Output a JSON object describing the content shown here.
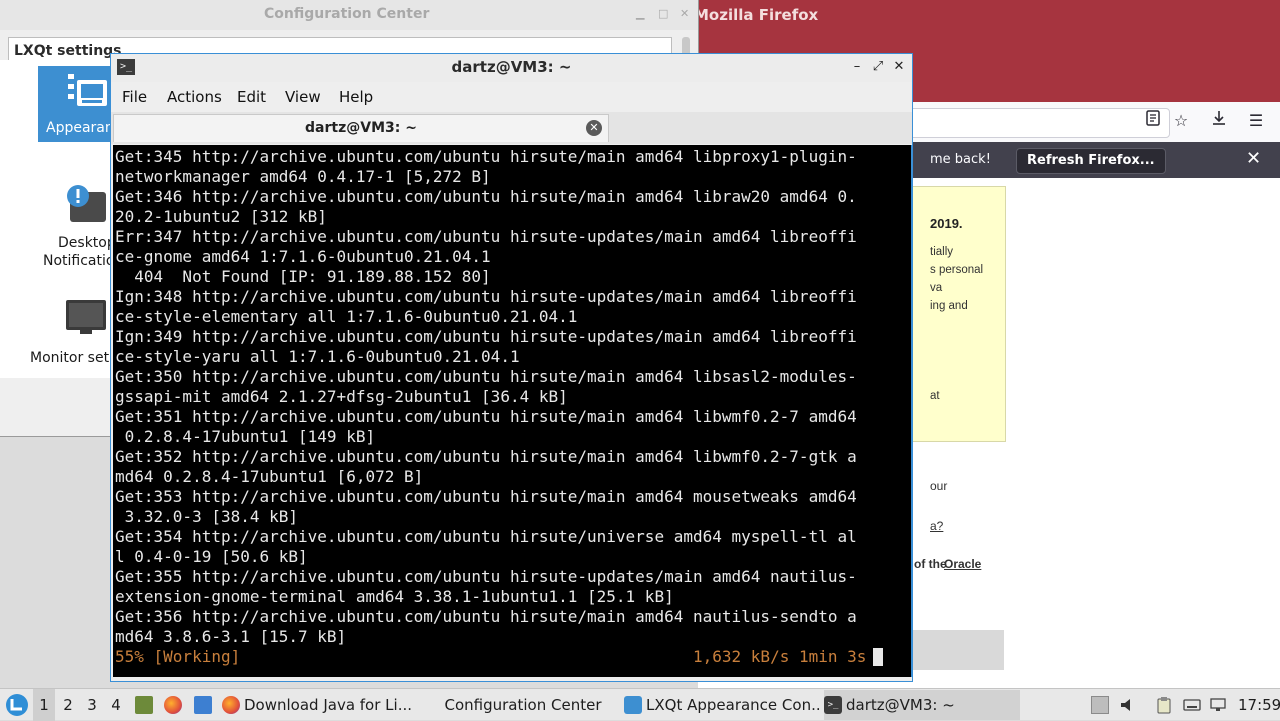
{
  "firefox": {
    "title": "Mozilla Firefox",
    "infobar_message": "me back!",
    "refresh_button": "Refresh Firefox...",
    "page": {
      "heading": "2019.",
      "yellow_lines": [
        "tially",
        "s personal",
        "va",
        "ing and",
        "at"
      ],
      "text_your": "our",
      "link_a": "a?",
      "text_of_the": "of the ",
      "link_oracle": "Oracle"
    }
  },
  "config_center": {
    "title": "Configuration Center",
    "section_label": "LXQt settings",
    "items": [
      {
        "label": "Appearance",
        "icon": "appearance-icon"
      },
      {
        "label": "Desktop Notifications",
        "icon": "notification-icon"
      },
      {
        "label": "Monitor settings",
        "icon": "monitor-icon"
      }
    ],
    "visible_labels": {
      "appearance": "Appearan",
      "desktop": "Desktop",
      "notifications": "Notification",
      "monitor": "Monitor set"
    }
  },
  "terminal": {
    "title": "dartz@VM3: ~",
    "menu": [
      "File",
      "Actions",
      "Edit",
      "View",
      "Help"
    ],
    "tab_title": "dartz@VM3: ~",
    "lines": [
      "Get:345 http://archive.ubuntu.com/ubuntu hirsute/main amd64 libproxy1-plugin-",
      "networkmanager amd64 0.4.17-1 [5,272 B]",
      "Get:346 http://archive.ubuntu.com/ubuntu hirsute/main amd64 libraw20 amd64 0.",
      "20.2-1ubuntu2 [312 kB]",
      "Err:347 http://archive.ubuntu.com/ubuntu hirsute-updates/main amd64 libreoffi",
      "ce-gnome amd64 1:7.1.6-0ubuntu0.21.04.1",
      "  404  Not Found [IP: 91.189.88.152 80]",
      "Ign:348 http://archive.ubuntu.com/ubuntu hirsute-updates/main amd64 libreoffi",
      "ce-style-elementary all 1:7.1.6-0ubuntu0.21.04.1",
      "Ign:349 http://archive.ubuntu.com/ubuntu hirsute-updates/main amd64 libreoffi",
      "ce-style-yaru all 1:7.1.6-0ubuntu0.21.04.1",
      "Get:350 http://archive.ubuntu.com/ubuntu hirsute/main amd64 libsasl2-modules-",
      "gssapi-mit amd64 2.1.27+dfsg-2ubuntu1 [36.4 kB]",
      "Get:351 http://archive.ubuntu.com/ubuntu hirsute/main amd64 libwmf0.2-7 amd64",
      " 0.2.8.4-17ubuntu1 [149 kB]",
      "Get:352 http://archive.ubuntu.com/ubuntu hirsute/main amd64 libwmf0.2-7-gtk a",
      "md64 0.2.8.4-17ubuntu1 [6,072 B]",
      "Get:353 http://archive.ubuntu.com/ubuntu hirsute/main amd64 mousetweaks amd64",
      " 3.32.0-3 [38.4 kB]",
      "Get:354 http://archive.ubuntu.com/ubuntu hirsute/universe amd64 myspell-tl al",
      "l 0.4-0-19 [50.6 kB]",
      "Get:355 http://archive.ubuntu.com/ubuntu hirsute-updates/main amd64 nautilus-",
      "extension-gnome-terminal amd64 3.38.1-1ubuntu1.1 [25.1 kB]",
      "Get:356 http://archive.ubuntu.com/ubuntu hirsute/main amd64 nautilus-sendto a",
      "md64 3.8.6-3.1 [15.7 kB]"
    ],
    "progress_left": "55% [Working]",
    "progress_right": "1,632 kB/s 1min 3s"
  },
  "taskbar": {
    "desktops": [
      "1",
      "2",
      "3",
      "4"
    ],
    "tasks": [
      {
        "label": "Download Java for Li...",
        "icon": "firefox-icon"
      },
      {
        "label": "Configuration Center",
        "icon": "settings-icon"
      },
      {
        "label": "LXQt Appearance Con...",
        "icon": "appearance-icon"
      },
      {
        "label": "dartz@VM3: ~",
        "icon": "terminal-icon"
      }
    ],
    "clock": "17:59"
  },
  "colors": {
    "firefox_titlebar": "#a6343f",
    "selection_blue": "#3d8fd1",
    "terminal_bg": "#000000",
    "terminal_fg": "#e8e8e8",
    "progress_orange": "#c87f3c"
  }
}
